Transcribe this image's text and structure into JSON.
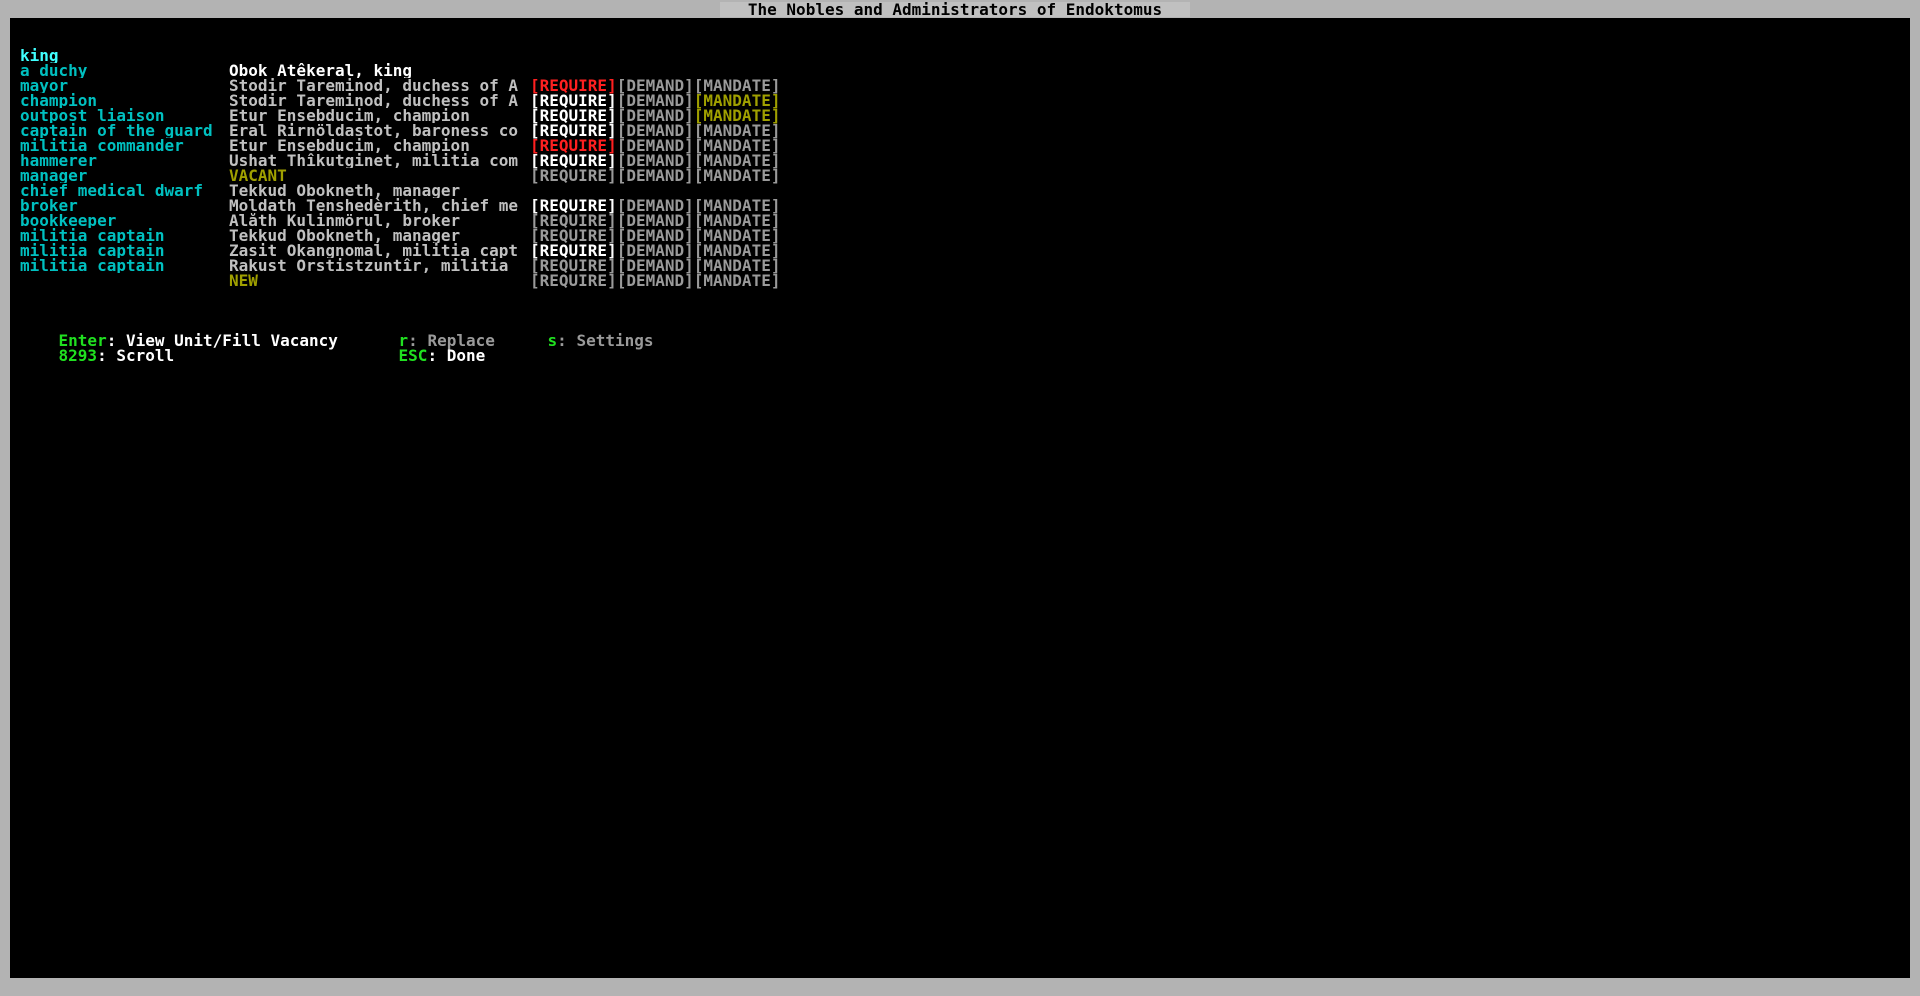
{
  "window": {
    "title": "The Nobles and Administrators of Endoktomus"
  },
  "nobles": [
    {
      "position": "king",
      "holder": "Obok Atêkeral, king",
      "require": "[REQUIRE]",
      "demand": "[DEMAND]",
      "mandate": "[MANDATE]"
    },
    {
      "position": "a duchy",
      "holder": "Stodir Tareminod, duchess of A",
      "require": "[REQUIRE]",
      "demand": "[DEMAND]",
      "mandate": "[MANDATE]"
    },
    {
      "position": "mayor",
      "holder": "Stodir Tareminod, duchess of A",
      "require": "[REQUIRE]",
      "demand": "[DEMAND]",
      "mandate": "[MANDATE]"
    },
    {
      "position": "champion",
      "holder": "Etur Ensebducim, champion",
      "require": "[REQUIRE]",
      "demand": "[DEMAND]",
      "mandate": "[MANDATE]"
    },
    {
      "position": "outpost liaison",
      "holder": "Eral Rirnöldastot, baroness co",
      "require": "[REQUIRE]",
      "demand": "[DEMAND]",
      "mandate": "[MANDATE]"
    },
    {
      "position": "captain of the guard",
      "holder": "Etur Ensebducim, champion",
      "require": "[REQUIRE]",
      "demand": "[DEMAND]",
      "mandate": "[MANDATE]"
    },
    {
      "position": "militia commander",
      "holder": "Ushat Thîkutginet, militia com",
      "require": "[REQUIRE]",
      "demand": "[DEMAND]",
      "mandate": "[MANDATE]"
    },
    {
      "position": "hammerer",
      "holder": "VACANT",
      "require": "",
      "demand": "",
      "mandate": ""
    },
    {
      "position": "manager",
      "holder": "Tekkud Obokneth, manager",
      "require": "[REQUIRE]",
      "demand": "[DEMAND]",
      "mandate": "[MANDATE]"
    },
    {
      "position": "chief medical dwarf",
      "holder": "Moldath Tenshedèrith, chief me",
      "require": "[REQUIRE]",
      "demand": "[DEMAND]",
      "mandate": "[MANDATE]"
    },
    {
      "position": "broker",
      "holder": "Alåth Kulinmörul, broker",
      "require": "[REQUIRE]",
      "demand": "[DEMAND]",
      "mandate": "[MANDATE]"
    },
    {
      "position": "bookkeeper",
      "holder": "Tekkud Obokneth, manager",
      "require": "[REQUIRE]",
      "demand": "[DEMAND]",
      "mandate": "[MANDATE]"
    },
    {
      "position": "militia captain",
      "holder": "Zasit Okangnomal, militia capt",
      "require": "[REQUIRE]",
      "demand": "[DEMAND]",
      "mandate": "[MANDATE]"
    },
    {
      "position": "militia captain",
      "holder": "Rakust Orstistzuntîr, militia",
      "require": "[REQUIRE]",
      "demand": "[DEMAND]",
      "mandate": "[MANDATE]"
    },
    {
      "position": "militia captain",
      "holder": "NEW",
      "require": "",
      "demand": "",
      "mandate": ""
    }
  ],
  "help": {
    "enter_key": "Enter",
    "enter_label": ": View Unit/Fill Vacancy",
    "r_key": "r",
    "r_label": ": Replace",
    "s_key": "s",
    "s_label": ": Settings",
    "scroll_key": "8293",
    "scroll_label": ": Scroll",
    "esc_key": "ESC",
    "esc_label": ": Done"
  },
  "colors": {
    "background": "#000000",
    "frame": "#b3b3b3",
    "position_text": "#00c0c0",
    "selected_position": "#40ffff",
    "holder_text": "#ffffff",
    "require_active": "#ff2020",
    "require_met": "#ffffff",
    "inactive": "#9a9a9a",
    "mandate_active": "#a0a000",
    "vacant": "#a0a000",
    "hotkey": "#20e020"
  }
}
